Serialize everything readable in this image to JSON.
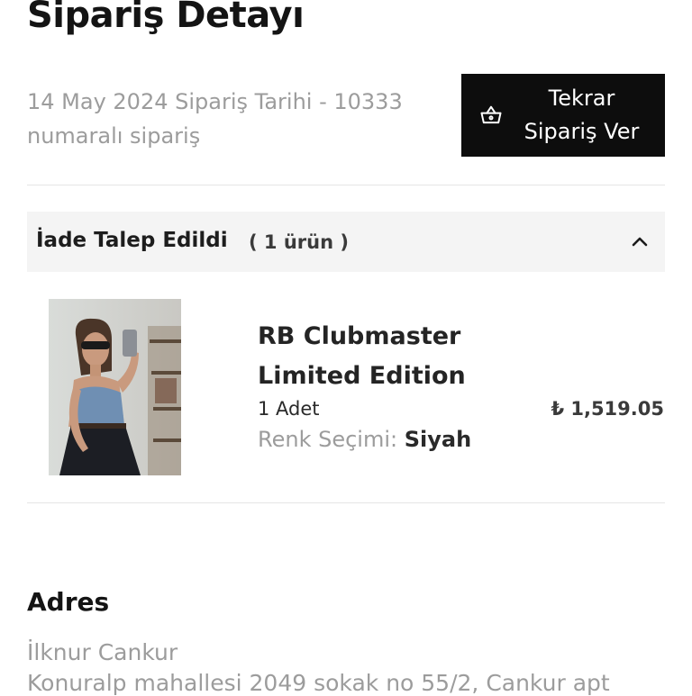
{
  "page": {
    "title": "Sipariş Detayı"
  },
  "order": {
    "meta": "14 May 2024 Sipariş Tarihi - 10333 numaralı sipariş",
    "reorder_button": {
      "line1": "Tekrar",
      "line2": "Sipariş Ver",
      "icon": "basket-icon"
    }
  },
  "item_group": {
    "status": "İade Talep Edildi",
    "count": "( 1 ürün )",
    "toggle_icon": "chevron-up-icon",
    "items": [
      {
        "name": "RB Clubmaster Limited Edition",
        "quantity": "1 Adet",
        "price": "₺ 1,519.05",
        "color_label": "Renk Seçimi:",
        "color_value": "Siyah",
        "image": "product-photo"
      }
    ]
  },
  "address": {
    "title": "Adres",
    "name": "İlknur Cankur",
    "line": "Konuralp mahallesi 2049 sokak no 55/2, Cankur apt"
  }
}
